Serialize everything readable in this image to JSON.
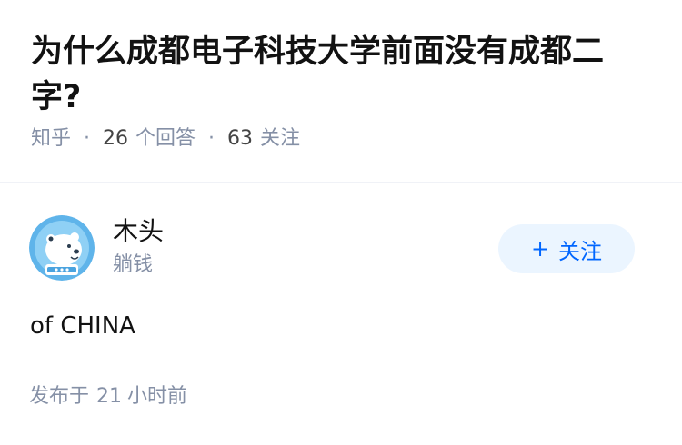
{
  "question": {
    "title": "为什么成都电子科技大学前面没有成都二字?",
    "source": "知乎",
    "answer_count": "26",
    "answer_label": "个回答",
    "follower_count": "63",
    "follower_label": "关注"
  },
  "answer": {
    "author_name": "木头",
    "author_headline": "躺钱",
    "follow_label": "关注",
    "content": "of CHINA",
    "published_prefix": "发布于",
    "published_num": "21",
    "published_suffix": "小时前"
  },
  "colors": {
    "accent": "#0066ff",
    "accent_bg": "#ebf5ff",
    "meta_text": "#8590a6",
    "avatar_bg": "#5fb4ea"
  },
  "icons": {
    "avatar": "polar-bear-astronaut-avatar",
    "follow": "plus-icon"
  }
}
